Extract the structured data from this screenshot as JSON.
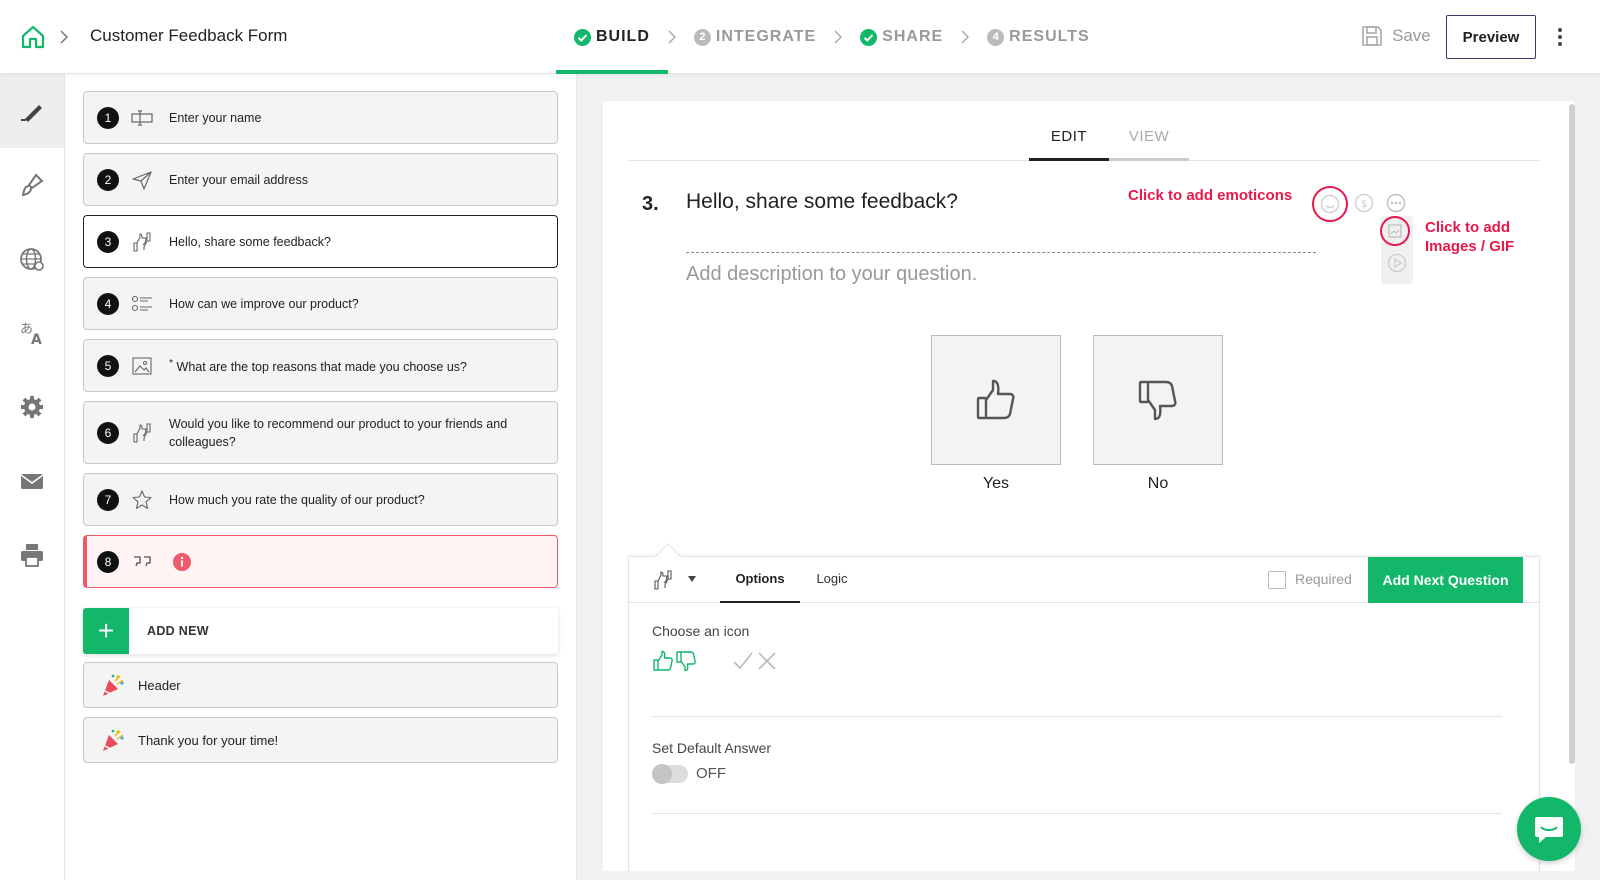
{
  "header": {
    "form_title": "Customer Feedback Form",
    "steps": [
      {
        "label": "BUILD",
        "status": "done",
        "active": true
      },
      {
        "label": "INTEGRATE",
        "number": "2",
        "status": "pending"
      },
      {
        "label": "SHARE",
        "status": "done"
      },
      {
        "label": "RESULTS",
        "number": "4",
        "status": "pending"
      }
    ],
    "save_label": "Save",
    "preview_label": "Preview"
  },
  "rail": {
    "items": [
      "build-pen-icon",
      "design-brush-icon",
      "globe-icon",
      "translate-icon",
      "gear-icon",
      "mail-icon",
      "printer-icon"
    ],
    "active": "build-pen-icon"
  },
  "questions": [
    {
      "number": "1",
      "text": "Enter your name",
      "icon": "text-input-icon"
    },
    {
      "number": "2",
      "text": "Enter your email address",
      "icon": "send-icon"
    },
    {
      "number": "3",
      "text": "Hello, share some feedback?",
      "icon": "thumbs-icon",
      "selected": true
    },
    {
      "number": "4",
      "text": "How can we improve our product?",
      "icon": "checklist-icon"
    },
    {
      "number": "5",
      "text": "What are the top reasons that made you choose us?",
      "required_mark": "*",
      "icon": "image-choice-icon"
    },
    {
      "number": "6",
      "text": "Would you like to recommend our product to your friends and colleagues?",
      "icon": "thumbs-icon"
    },
    {
      "number": "7",
      "text": "How much you rate the quality of our product?",
      "icon": "star-icon"
    },
    {
      "number": "8",
      "text": "",
      "icon": "quote-icon",
      "error": true
    }
  ],
  "add_new_label": "ADD NEW",
  "end_screens": [
    {
      "label": "Header",
      "icon": "party-popper-icon"
    },
    {
      "label": "Thank you for your time!",
      "icon": "party-popper-icon"
    }
  ],
  "editor": {
    "tabs": {
      "edit": "EDIT",
      "view": "VIEW"
    },
    "question_number": "3.",
    "question_title": "Hello, share some feedback?",
    "description_placeholder": "Add description to your question.",
    "annotation_emoticons": "Click to add emoticons",
    "annotation_images_line1": "Click to add",
    "annotation_images_line2": "Images / GIF",
    "choices": [
      {
        "label": "Yes",
        "icon": "thumbs-up-icon"
      },
      {
        "label": "No",
        "icon": "thumbs-down-icon"
      }
    ]
  },
  "options_panel": {
    "tabs": {
      "options": "Options",
      "logic": "Logic"
    },
    "required_label": "Required",
    "add_next_label": "Add Next Question",
    "choose_icon_label": "Choose an icon",
    "icon_sets": [
      "thumbs-up-down-icon",
      "check-cross-icon"
    ],
    "default_answer_label": "Set Default Answer",
    "default_answer_state": "OFF"
  },
  "colors": {
    "accent": "#12b76a",
    "annotation": "#e6194b",
    "error": "#ef5a6a"
  }
}
